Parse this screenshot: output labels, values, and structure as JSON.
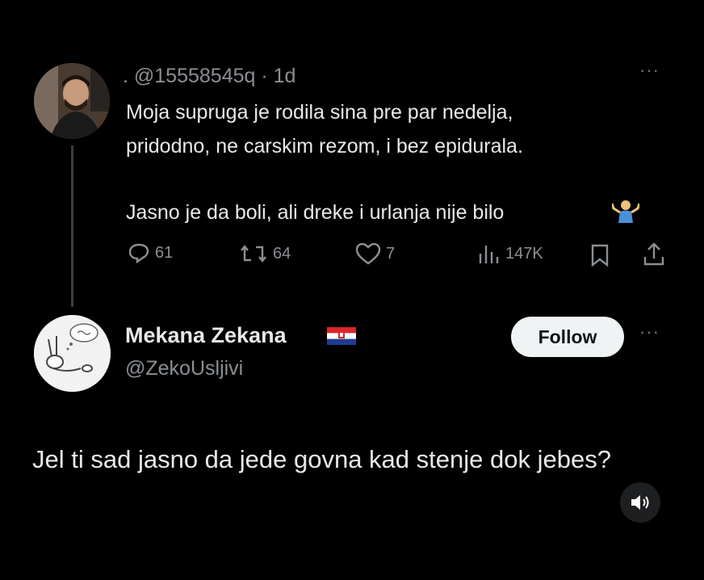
{
  "original_tweet": {
    "meta": ". @15558545q · 1d",
    "more": "···",
    "text_line1": "Moja supruga je rodila sina pre par nedelja,",
    "text_line2": "pridodno, ne carskim rezom, i bez epidurala.",
    "text_line3": "Jasno je da boli, ali dreke i urlanja nije bilo",
    "emoji": "man-shrugging",
    "stats": {
      "replies": "61",
      "retweets": "64",
      "likes": "7",
      "views": "147K"
    }
  },
  "reply": {
    "name": "Mekana Zekana",
    "handle": "@ZekoUsljivi",
    "follow_label": "Follow",
    "more": "···",
    "text": "Jel ti sad jasno da jede govna kad stenje dok jebes?"
  },
  "colors": {
    "background": "#000000",
    "text": "#e7e9ea",
    "muted": "#8b8f94",
    "follow_bg": "#eff3f4"
  },
  "icons": [
    "reply-icon",
    "retweet-icon",
    "like-icon",
    "views-icon",
    "bookmark-icon",
    "share-icon",
    "more-icon",
    "sound-icon",
    "croatia-flag-icon"
  ]
}
